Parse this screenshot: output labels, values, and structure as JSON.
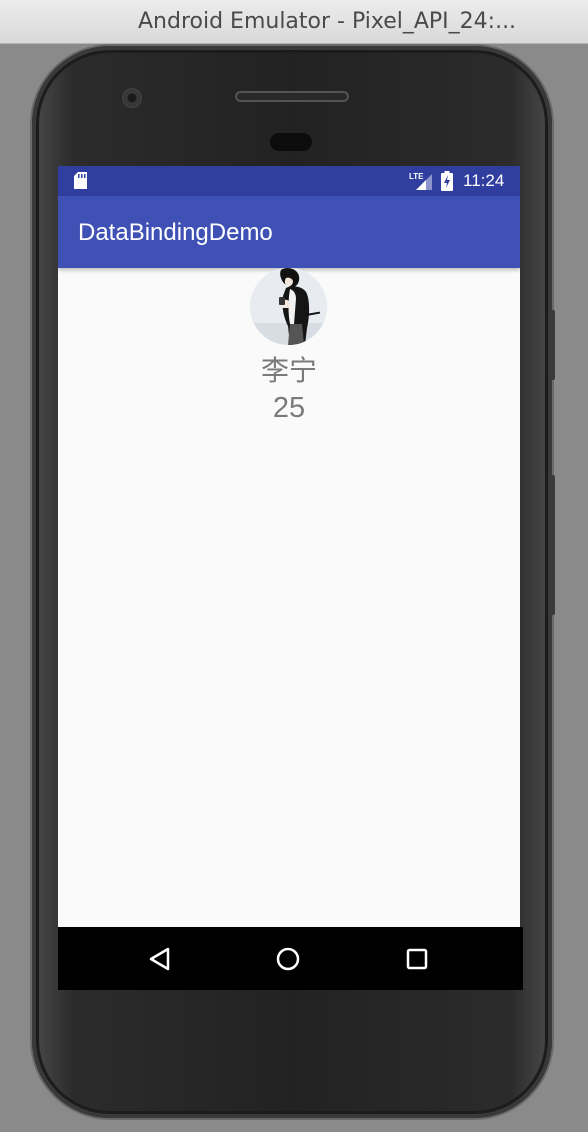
{
  "window": {
    "title": "Android Emulator - Pixel_API_24:..."
  },
  "status_bar": {
    "time": "11:24",
    "network_label": "LTE",
    "color": "#303f9f"
  },
  "app_bar": {
    "title": "DataBindingDemo",
    "color": "#3f51b5"
  },
  "profile": {
    "avatar_icon": "avatar-image",
    "name": "李宁",
    "age": "25"
  },
  "nav_bar": {
    "back_icon": "back-triangle-icon",
    "home_icon": "home-circle-icon",
    "recents_icon": "recents-square-icon"
  }
}
